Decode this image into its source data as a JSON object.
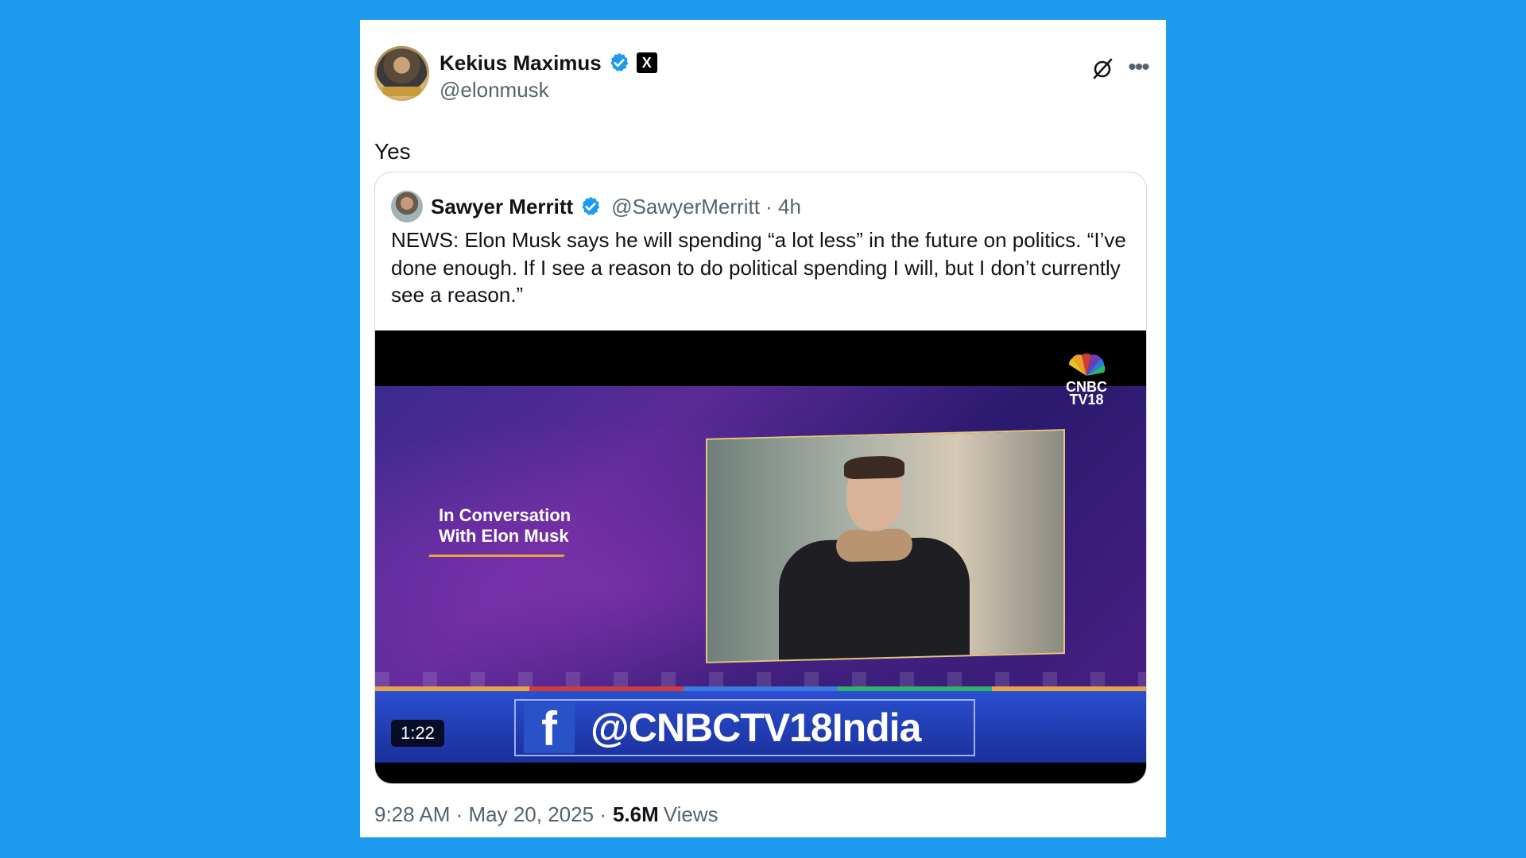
{
  "post": {
    "author": {
      "display_name": "Kekius Maximus",
      "handle": "@elonmusk",
      "verified": true,
      "affiliate_badge": "X"
    },
    "text": "Yes",
    "timestamp": "9:28 AM · May 20, 2025 ·",
    "views_count": "5.6M",
    "views_label": "Views",
    "icons": {
      "grok": "grok-icon",
      "more": "more-icon"
    }
  },
  "quoted": {
    "author": {
      "display_name": "Sawyer Merritt",
      "handle_time": "@SawyerMerritt · 4h",
      "verified": true
    },
    "text": "NEWS: Elon Musk says he will spending “a lot less” in the future on politics. “I’ve done enough. If I see a reason to do political spending I will, but I don’t currently see a reason.”",
    "video": {
      "overlay_title": "In Conversation With Elon Musk",
      "logo_line1": "CNBC",
      "logo_line2": "TV18",
      "fb_letter": "f",
      "ticker_handle": "@CNBCTV18India",
      "duration": "1:22"
    }
  },
  "colors": {
    "background": "#1d9bf0",
    "verified_blue": "#1d9bf0",
    "text_primary": "#0f1419",
    "text_secondary": "#536471"
  }
}
